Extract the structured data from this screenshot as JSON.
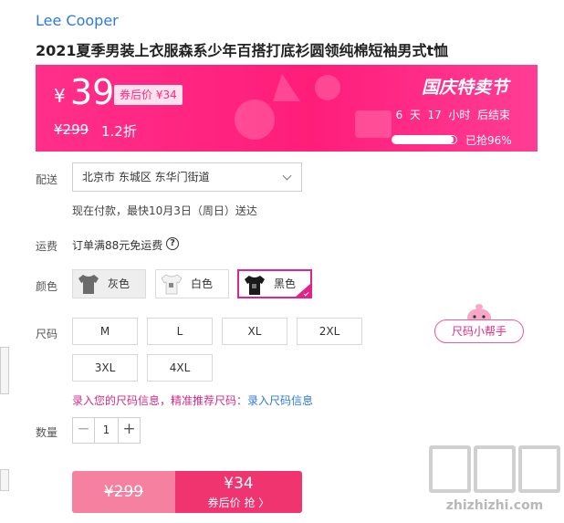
{
  "brand": "Lee Cooper",
  "product_title": "2021夏季男装上衣服森系少年百搭打底衫圆领纯棉短袖男式t恤",
  "promo": {
    "currency": "¥",
    "price": "39",
    "coupon_price": "券后价 ¥34",
    "original_price": "¥299",
    "discount": "1.2折",
    "festival": "国庆特卖节",
    "countdown": "6  天  17  小时  后结束",
    "sold_fraction": 0.96,
    "sold_text": "已抢96%"
  },
  "delivery": {
    "label": "配送",
    "address": "北京市 东城区 东华门街道",
    "estimate": "现在付款，最快10月3日（周日）送达"
  },
  "shipping": {
    "label": "运费",
    "text": "订单满88元免运费",
    "help_icon": "?"
  },
  "colors": {
    "label": "颜色",
    "options": [
      {
        "name": "灰色",
        "swatch": "#6b6b6b",
        "selected": false
      },
      {
        "name": "白色",
        "swatch": "#f2f2f2",
        "selected": false
      },
      {
        "name": "黑色",
        "swatch": "#1a1a1a",
        "selected": true
      }
    ]
  },
  "sizes": {
    "label": "尺码",
    "options": [
      "M",
      "L",
      "XL",
      "2XL",
      "3XL",
      "4XL"
    ],
    "helper": "尺码小帮手",
    "recommend_text": "录入您的尺码信息，精准推荐尺码：",
    "recommend_link": "录入尺码信息"
  },
  "quantity": {
    "label": "数量",
    "value": "1",
    "minus": "−",
    "plus": "+"
  },
  "buy": {
    "original_price": "¥299",
    "coupon_price": "¥34",
    "coupon_action": "券后价 抢 〉"
  },
  "watermark": "zhizhizhi.com",
  "accent_colors": {
    "promo_pink": "#ff1d7a",
    "selected_border": "#e0248a",
    "link_blue": "#2e7bd6",
    "buy_red": "#ef3470"
  }
}
